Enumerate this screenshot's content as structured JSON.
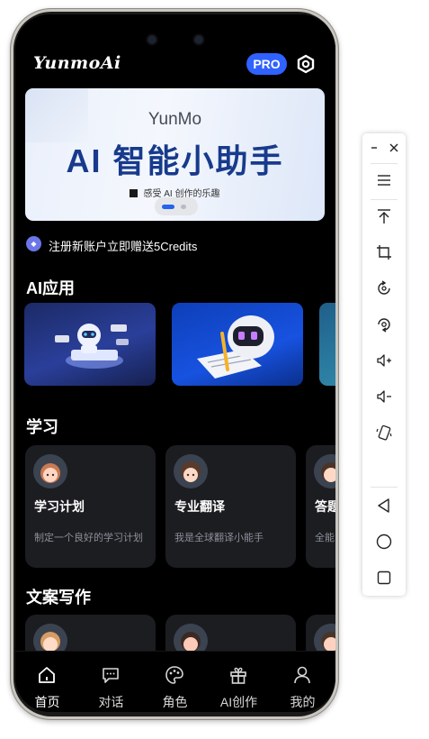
{
  "app": {
    "logo": "YunmoAi",
    "pro_badge": "PRO"
  },
  "banner": {
    "subtitle": "YunMo",
    "title": "AI 智能小助手",
    "tagline": "感受 AI 创作的乐趣"
  },
  "notice": {
    "text": "注册新账户立即赠送5Credits"
  },
  "sections": {
    "ai_apps": "AI应用",
    "study": "学习",
    "copywriting": "文案写作"
  },
  "study_cards": [
    {
      "name": "学习计划",
      "desc": "制定一个良好的学习计划"
    },
    {
      "name": "专业翻译",
      "desc": "我是全球翻译小能手"
    },
    {
      "name": "答题",
      "desc": "全能"
    }
  ],
  "tabs": [
    {
      "label": "首页",
      "icon": "home-icon"
    },
    {
      "label": "对话",
      "icon": "chat-icon"
    },
    {
      "label": "角色",
      "icon": "palette-icon"
    },
    {
      "label": "AI创作",
      "icon": "gift-icon"
    },
    {
      "label": "我的",
      "icon": "user-icon"
    }
  ],
  "toolbar": {
    "icons": [
      "minimize-icon",
      "close-icon",
      "menu-icon",
      "pin-top-icon",
      "crop-icon",
      "rotate-icon",
      "screen-rotate-icon",
      "volume-up-icon",
      "volume-down-icon",
      "shake-icon",
      "back-icon",
      "home-circle-icon",
      "overview-icon"
    ]
  },
  "colors": {
    "accent": "#2f62ff",
    "background": "#000000",
    "card": "#1c1d21",
    "banner_title": "#173a8c"
  }
}
